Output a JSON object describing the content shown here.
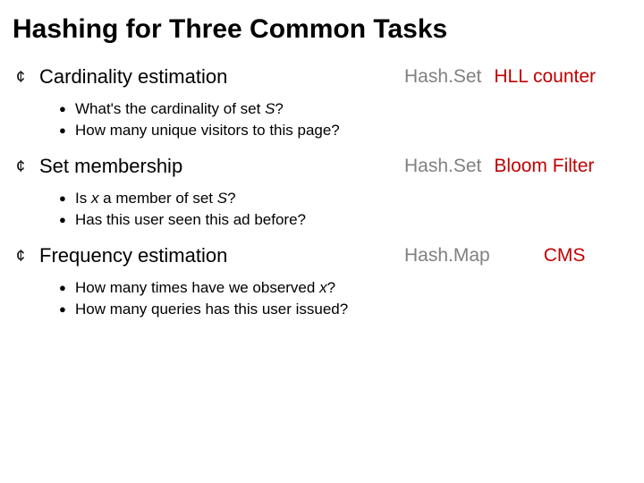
{
  "title": "Hashing for Three Common Tasks",
  "sections": [
    {
      "heading": "Cardinality estimation",
      "items": [
        {
          "pre": "What's the cardinality of set ",
          "ital": "S",
          "post": "?"
        },
        {
          "pre": "How many unique visitors to this page?",
          "ital": "",
          "post": ""
        }
      ],
      "tag_gray": "Hash.Set",
      "tag_red": "HLL counter"
    },
    {
      "heading": "Set membership",
      "items": [
        {
          "pre": "Is ",
          "ital": "x",
          "post": " a member of set ",
          "ital2": "S",
          "post2": "?"
        },
        {
          "pre": "Has this user seen this ad before?",
          "ital": "",
          "post": ""
        }
      ],
      "tag_gray": "Hash.Set",
      "tag_red": "Bloom Filter"
    },
    {
      "heading": "Frequency estimation",
      "items": [
        {
          "pre": "How many times have we observed ",
          "ital": "x",
          "post": "?"
        },
        {
          "pre": "How many queries has this user issued?",
          "ital": "",
          "post": ""
        }
      ],
      "tag_gray": "Hash.Map",
      "tag_red": "CMS"
    }
  ]
}
